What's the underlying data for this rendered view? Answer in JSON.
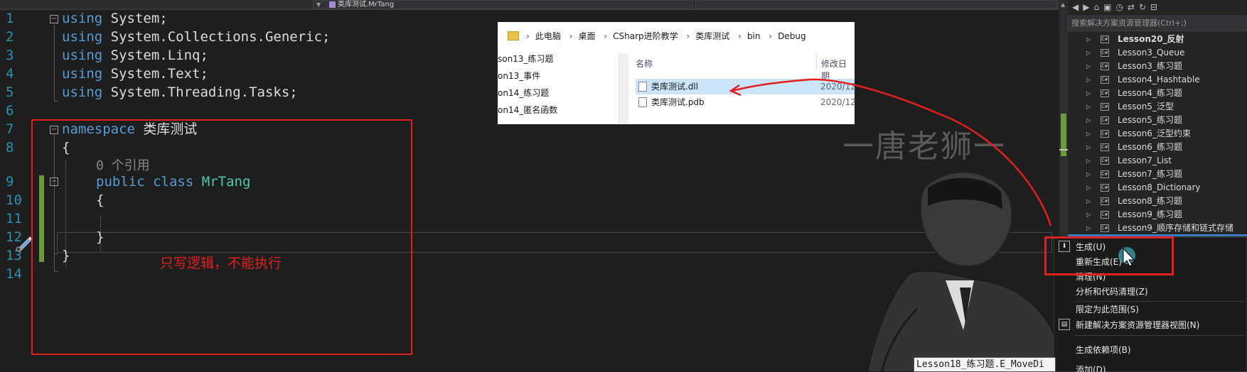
{
  "topbar": {
    "file_combo": "类库测试.MrTang"
  },
  "editor": {
    "line_numbers": [
      "1",
      "2",
      "3",
      "4",
      "5",
      "6",
      "7",
      "8",
      "",
      "9",
      "10",
      "11",
      "12",
      "13",
      "14"
    ],
    "lines": [
      {
        "kw": "using",
        "rest": " System;"
      },
      {
        "kw": "using",
        "rest": " System.Collections.Generic;"
      },
      {
        "kw": "using",
        "rest": " System.Linq;"
      },
      {
        "kw": "using",
        "rest": " System.Text;"
      },
      {
        "kw": "using",
        "rest": " System.Threading.Tasks;"
      }
    ],
    "namespace_kw": "namespace",
    "namespace_name": "类库测试",
    "open_brace": "{",
    "close_brace": "}",
    "ref_count": "0 个引用",
    "public_kw": "public",
    "class_kw": "class",
    "class_name": "MrTang",
    "class_open": "{",
    "class_close": "}",
    "annotation": "只写逻辑，不能执行"
  },
  "explorer": {
    "breadcrumb": [
      "此电脑",
      "桌面",
      "CSharp进阶教学",
      "类库测试",
      "bin",
      "Debug"
    ],
    "left_items": [
      "son13_练习题",
      "on13_事件",
      "on14_练习题",
      "on14_匿名函数"
    ],
    "col_name": "名称",
    "col_date": "修改日期",
    "files": [
      {
        "name": "类库测试.dll",
        "date": "2020/12"
      },
      {
        "name": "类库测试.pdb",
        "date": "2020/12"
      }
    ]
  },
  "watermark": "一唐老狮一",
  "solution_explorer": {
    "toolbar_icons": [
      "back-icon",
      "forward-icon",
      "home-icon",
      "solution-icon",
      "sync-icon",
      "history-icon",
      "refresh-icon",
      "collapse-icon"
    ],
    "search_placeholder": "搜索解决方案资源管理器(Ctrl+;)",
    "projects": [
      {
        "name": "Lesson20_反射",
        "bold": true
      },
      {
        "name": "Lesson3_Queue"
      },
      {
        "name": "Lesson3_练习题"
      },
      {
        "name": "Lesson4_Hashtable"
      },
      {
        "name": "Lesson4_练习题"
      },
      {
        "name": "Lesson5_泛型"
      },
      {
        "name": "Lesson5_练习题"
      },
      {
        "name": "Lesson6_泛型约束"
      },
      {
        "name": "Lesson6_练习题"
      },
      {
        "name": "Lesson7_List"
      },
      {
        "name": "Lesson7_练习题"
      },
      {
        "name": "Lesson8_Dictionary"
      },
      {
        "name": "Lesson8_练习题"
      },
      {
        "name": "Lesson9_练习题"
      },
      {
        "name": "Lesson9_顺序存储和链式存储"
      }
    ]
  },
  "context_menu": {
    "items": [
      "生成(U)",
      "重新生成(E)",
      "清理(N)",
      "分析和代码清理(Z)",
      "限定为此范围(S)",
      "新建解决方案资源管理器视图(N)",
      "生成依赖项(B)",
      "添加(D)"
    ]
  },
  "tooltip": "Lesson18_练习题.E_MoveDi"
}
